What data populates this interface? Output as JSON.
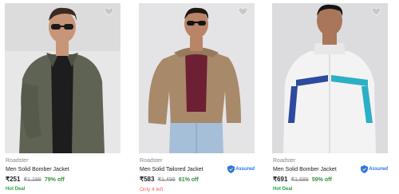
{
  "products": [
    {
      "brand": "Roadster",
      "name": "Men Solid Bomber Jacket",
      "price": "₹251",
      "mrp": "₹1,199",
      "discount": "79% off",
      "tag": "Hot Deal",
      "assured": "",
      "colors": {
        "bg": "#e7e7e7",
        "jacket": "#5f6354",
        "shirt": "#1d1d1d",
        "skin": "#c79577"
      }
    },
    {
      "brand": "Roadster",
      "name": "Men Solid Tailored Jacket",
      "price": "₹583",
      "mrp": "₹1,499",
      "discount": "61% off",
      "tag": "Only 4 left",
      "assured": "Assured",
      "colors": {
        "bg": "#e4e4e6",
        "jacket": "#a8896a",
        "shirt": "#6d1f33",
        "jeans": "#a6bfd8",
        "skin": "#b98468"
      }
    },
    {
      "brand": "Roadster",
      "name": "Men Solid Bomber Jacket",
      "price": "₹691",
      "mrp": "₹1,699",
      "discount": "59% off",
      "tag": "Hot Deal",
      "assured": "Assured",
      "colors": {
        "bg": "#dcdcdf",
        "jacket": "#f3f3f3",
        "stripe1": "#2e4a9e",
        "stripe2": "#2ab0c5",
        "skin": "#a9765a"
      }
    }
  ]
}
